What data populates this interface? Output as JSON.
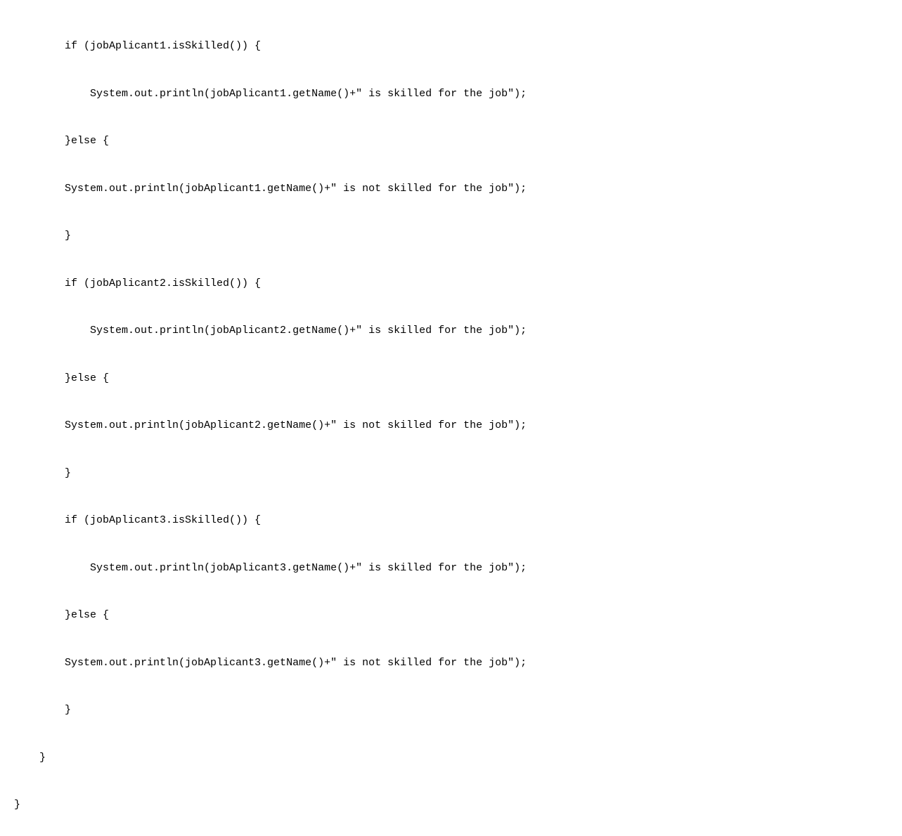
{
  "code": {
    "lines": [
      {
        "indent": 2,
        "text": "if (jobAplicant1.isSkilled()) {"
      },
      {
        "indent": 3,
        "text": "System.out.println(jobAplicant1.getName()+\" is skilled for the job\");"
      },
      {
        "indent": 2,
        "text": "}else {"
      },
      {
        "indent": 2,
        "text": "System.out.println(jobAplicant1.getName()+\" is not skilled for the job\");"
      },
      {
        "indent": 2,
        "text": "}"
      },
      {
        "indent": 2,
        "text": "if (jobAplicant2.isSkilled()) {"
      },
      {
        "indent": 3,
        "text": "System.out.println(jobAplicant2.getName()+\" is skilled for the job\");"
      },
      {
        "indent": 2,
        "text": "}else {"
      },
      {
        "indent": 2,
        "text": "System.out.println(jobAplicant2.getName()+\" is not skilled for the job\");"
      },
      {
        "indent": 2,
        "text": "}"
      },
      {
        "indent": 2,
        "text": "if (jobAplicant3.isSkilled()) {"
      },
      {
        "indent": 3,
        "text": "System.out.println(jobAplicant3.getName()+\" is skilled for the job\");"
      },
      {
        "indent": 2,
        "text": "}else {"
      },
      {
        "indent": 2,
        "text": "System.out.println(jobAplicant3.getName()+\" is not skilled for the job\");"
      },
      {
        "indent": 2,
        "text": "}"
      },
      {
        "indent": 1,
        "text": "}"
      },
      {
        "indent": 0,
        "text": "}"
      }
    ]
  }
}
